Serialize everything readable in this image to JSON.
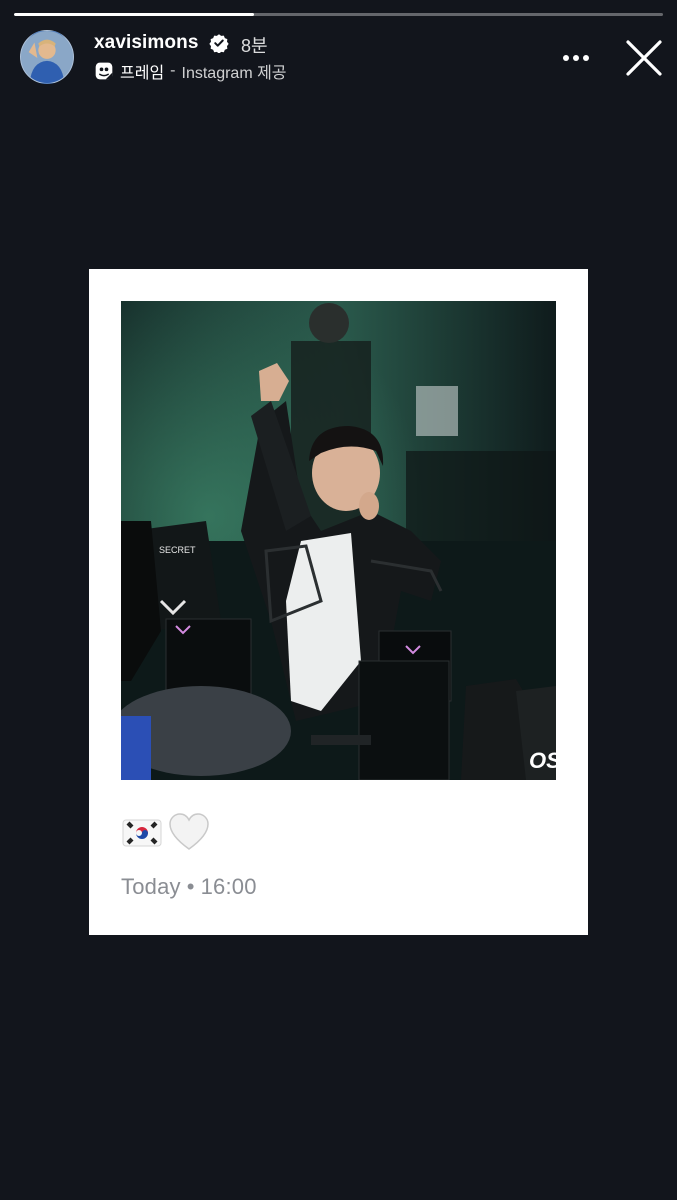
{
  "story": {
    "progress": 0.37
  },
  "header": {
    "username": "xavisimons",
    "verified": true,
    "time_ago": "8분",
    "source_name": "프레임",
    "source_separator": "-",
    "source_provider": "Instagram 제공",
    "icons": {
      "verified": "verified-badge-icon",
      "frame": "frame-sticker-icon",
      "more": "more-horizontal-icon",
      "close": "close-icon"
    }
  },
  "card": {
    "emoji": {
      "flag": "south-korea-flag-emoji",
      "heart": "white-heart-emoji"
    },
    "date_day": "Today",
    "date_separator": "•",
    "date_time": "16:00",
    "photo_watermark": "OS"
  },
  "colors": {
    "background": "#12151c",
    "card": "#ffffff",
    "caption_text": "#8a8d93"
  }
}
